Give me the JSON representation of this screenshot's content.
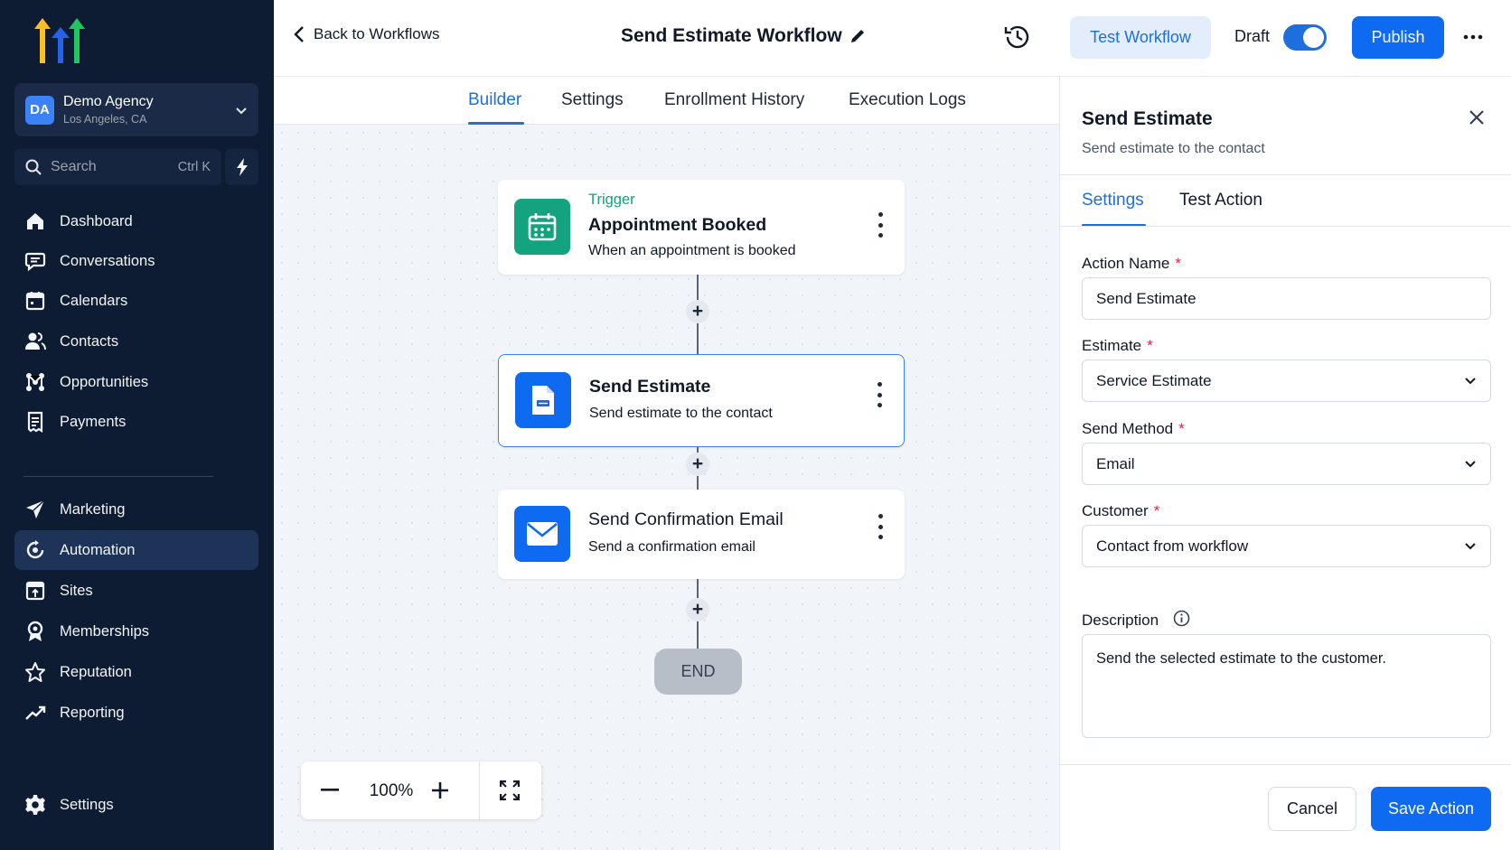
{
  "sidebar": {
    "account": {
      "initials": "DA",
      "name": "Demo Agency",
      "location": "Los Angeles, CA"
    },
    "search": {
      "placeholder": "Search",
      "shortcut": "Ctrl K"
    },
    "items": [
      {
        "label": "Dashboard",
        "icon": "home-icon"
      },
      {
        "label": "Conversations",
        "icon": "chat-icon"
      },
      {
        "label": "Calendars",
        "icon": "calendar-icon"
      },
      {
        "label": "Contacts",
        "icon": "contacts-icon"
      },
      {
        "label": "Opportunities",
        "icon": "opportunities-icon"
      },
      {
        "label": "Payments",
        "icon": "payments-icon"
      },
      {
        "label": "Marketing",
        "icon": "send-icon"
      },
      {
        "label": "Automation",
        "icon": "automation-icon",
        "active": true
      },
      {
        "label": "Sites",
        "icon": "sites-icon"
      },
      {
        "label": "Memberships",
        "icon": "memberships-icon"
      },
      {
        "label": "Reputation",
        "icon": "star-icon"
      },
      {
        "label": "Reporting",
        "icon": "chart-line-icon"
      }
    ],
    "settings_label": "Settings"
  },
  "topbar": {
    "back_label": "Back to Workflows",
    "workflow_title": "Send Estimate Workflow",
    "test_button": "Test Workflow",
    "status_label": "Draft",
    "publish_button": "Publish"
  },
  "tabs": [
    "Builder",
    "Settings",
    "Enrollment History",
    "Execution Logs"
  ],
  "canvas": {
    "nodes": [
      {
        "tag": "Trigger",
        "title": "Appointment Booked",
        "subtitle": "When an appointment is booked"
      },
      {
        "title": "Send Estimate",
        "subtitle": "Send estimate to the contact"
      },
      {
        "title": "Send Confirmation Email",
        "subtitle": "Send a confirmation email"
      }
    ],
    "end_label": "END",
    "add_step_label": "+",
    "zoom": "100%"
  },
  "panel": {
    "title": "Send Estimate",
    "subtitle": "Send estimate to the contact",
    "tabs": [
      "Settings",
      "Test Action"
    ],
    "fields": {
      "action_name": {
        "label": "Action Name",
        "value": "Send Estimate"
      },
      "estimate": {
        "label": "Estimate",
        "value": "Service Estimate"
      },
      "send_method": {
        "label": "Send Method",
        "value": "Email"
      },
      "customer": {
        "label": "Customer",
        "value": "Contact from workflow"
      },
      "description": {
        "label": "Description",
        "value": "Send the selected estimate to the customer."
      }
    },
    "required_mark": "*",
    "cancel_button": "Cancel",
    "save_button": "Save Action"
  },
  "colors": {
    "primary": "#0e6af0",
    "sidebar_bg": "#0d1b33",
    "trigger_green": "#10a37f"
  }
}
